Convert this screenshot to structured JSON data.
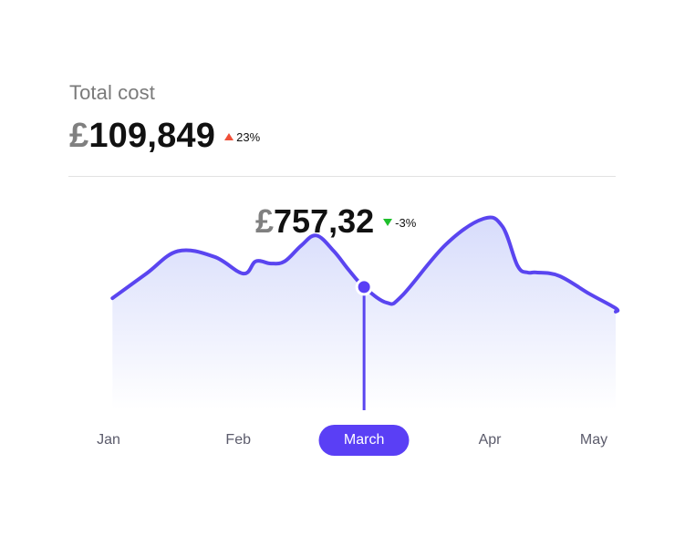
{
  "header": {
    "title": "Total cost",
    "currency_symbol": "£",
    "total_value": "109,849",
    "total_change": "23%",
    "total_change_direction": "up",
    "total_change_color": "#ef4f38"
  },
  "selected": {
    "currency_symbol": "£",
    "value": "757,32",
    "change": "-3%",
    "change_direction": "down",
    "change_color": "#1fbf2c",
    "month": "March"
  },
  "colors": {
    "accent": "#5a3ff5",
    "line": "#5a45f0",
    "area_top": "#d7dcfb",
    "area_bottom": "#ffffff",
    "divider": "#e2e2e2"
  },
  "chart_data": {
    "type": "area",
    "categories": [
      "Jan",
      "Feb",
      "March",
      "Apr",
      "May"
    ],
    "active_category": "March",
    "x": [
      0,
      0.27,
      0.52,
      0.81,
      1.04,
      1.14,
      1.26,
      1.37,
      1.5,
      1.62,
      1.76,
      1.88,
      2.0,
      2.18,
      2.3,
      2.65,
      2.95,
      3.1,
      3.22,
      3.3,
      3.37,
      3.55,
      3.79,
      4.0,
      4.35
    ],
    "values": [
      100,
      122,
      142,
      137,
      122,
      133,
      131,
      133,
      147,
      156,
      142,
      125,
      110,
      96,
      102,
      148,
      171,
      164,
      129,
      123,
      123,
      120,
      104,
      91,
      88
    ],
    "ylim": [
      0,
      175
    ],
    "xlim": [
      -0.35,
      4.0
    ],
    "grid": false,
    "title": "",
    "xlabel": "",
    "ylabel": ""
  }
}
